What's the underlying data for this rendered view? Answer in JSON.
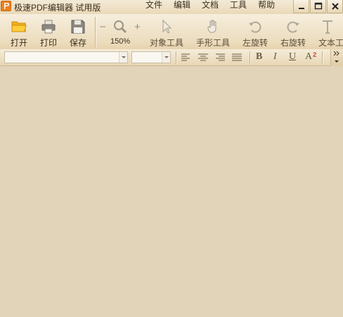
{
  "app": {
    "title": "极速PDF编辑器 试用版"
  },
  "menu": [
    "文件",
    "编辑",
    "文档",
    "工具",
    "帮助"
  ],
  "window_controls": [
    "minimize-icon",
    "maximize-icon",
    "close-icon"
  ],
  "toolbar": {
    "open": "打开",
    "print": "打印",
    "save": "保存",
    "zoom_minus": "−",
    "zoom_plus": "+",
    "zoom": "150%",
    "object_tool": "对象工具",
    "hand_tool": "手形工具",
    "rotate_left": "左旋转",
    "rotate_right": "右旋转",
    "text_tool": "文本工"
  },
  "format_bar": {
    "font_name": "",
    "font_size": "",
    "bold": "B",
    "italic": "I",
    "underline": "U",
    "superscript": "A"
  },
  "colors": {
    "background": "#e2d4b8",
    "toolbar": "#ecdcbd",
    "logo": "#e8821f"
  }
}
